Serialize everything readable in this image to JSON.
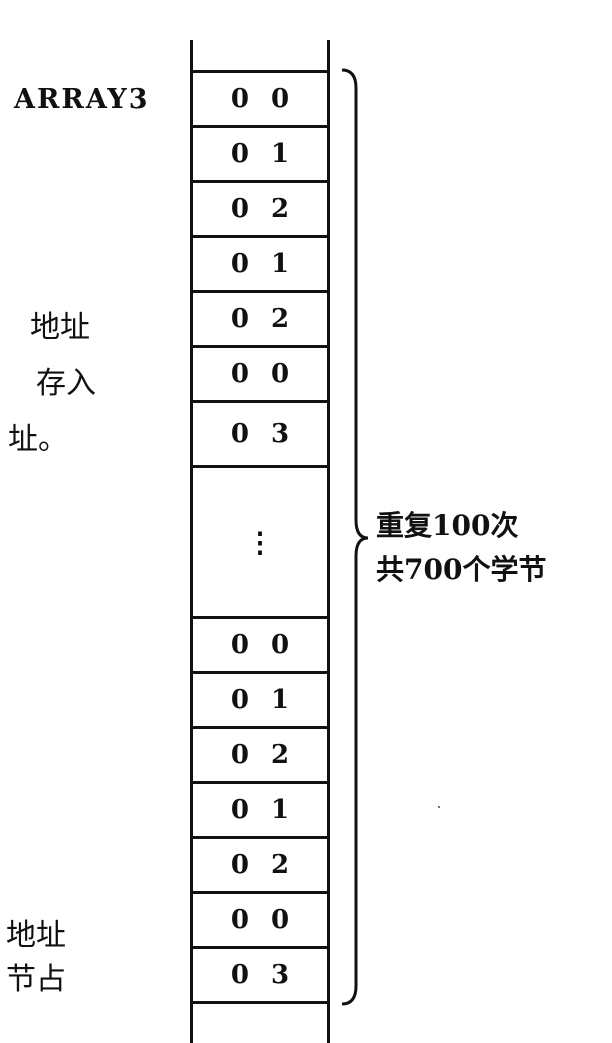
{
  "array_label": "ARRAY3",
  "cells_top": [
    {
      "hi": "0",
      "lo": "0"
    },
    {
      "hi": "0",
      "lo": "1"
    },
    {
      "hi": "0",
      "lo": "2"
    },
    {
      "hi": "0",
      "lo": "1"
    },
    {
      "hi": "0",
      "lo": "2"
    },
    {
      "hi": "0",
      "lo": "0"
    },
    {
      "hi": "0",
      "lo": "3"
    }
  ],
  "ellipsis": "⋮",
  "cells_bottom": [
    {
      "hi": "0",
      "lo": "0"
    },
    {
      "hi": "0",
      "lo": "1"
    },
    {
      "hi": "0",
      "lo": "2"
    },
    {
      "hi": "0",
      "lo": "1"
    },
    {
      "hi": "0",
      "lo": "2"
    },
    {
      "hi": "0",
      "lo": "0"
    },
    {
      "hi": "0",
      "lo": "3"
    }
  ],
  "left_text_top": [
    "地址",
    "存入",
    "址。"
  ],
  "left_text_bottom": [
    "地址",
    "节占"
  ],
  "brace_label": [
    "重复100次",
    "共700个学节"
  ],
  "colors": {
    "ink": "#111111",
    "background": "#ffffff"
  }
}
